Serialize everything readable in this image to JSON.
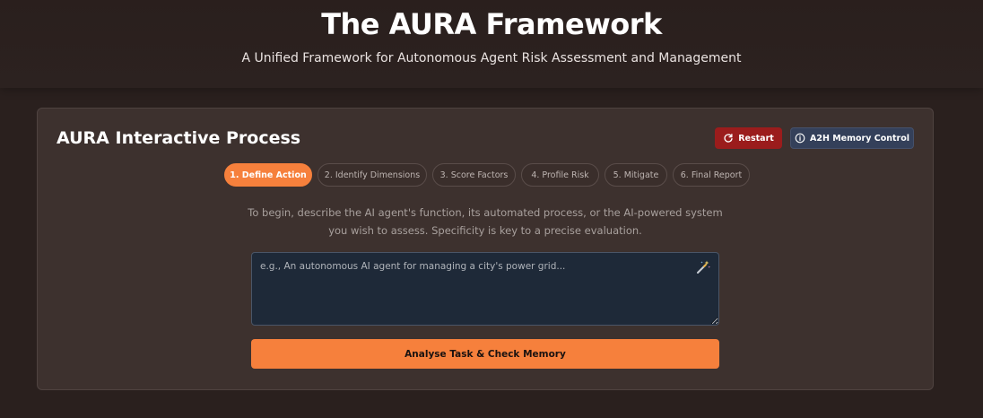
{
  "header": {
    "title": "The AURA Framework",
    "subtitle": "A Unified Framework for Autonomous Agent Risk Assessment and Management"
  },
  "panel": {
    "title": "AURA Interactive Process",
    "restart_label": "Restart",
    "memory_label": "A2H Memory Control",
    "steps": [
      {
        "label": "1. Define Action",
        "active": true
      },
      {
        "label": "2. Identify Dimensions",
        "active": false
      },
      {
        "label": "3. Score Factors",
        "active": false
      },
      {
        "label": "4. Profile Risk",
        "active": false
      },
      {
        "label": "5. Mitigate",
        "active": false
      },
      {
        "label": "6. Final Report",
        "active": false
      }
    ],
    "instructions": "To begin, describe the AI agent's function, its automated process, or the AI-powered system you wish to assess. Specificity is key to a precise evaluation.",
    "task_input": {
      "value": "",
      "placeholder": "e.g., An autonomous AI agent for managing a city's power grid..."
    },
    "analyse_label": "Analyse Task & Check Memory"
  },
  "icons": {
    "restart": "refresh-icon",
    "memory": "info-circle-icon",
    "wand": "magic-wand-icon"
  },
  "colors": {
    "accent": "#f6803c",
    "restart": "#9b1c1c",
    "memory": "#34405a",
    "background": "#2a201e",
    "panel": "#3d312e",
    "input_bg": "#1e2938"
  }
}
